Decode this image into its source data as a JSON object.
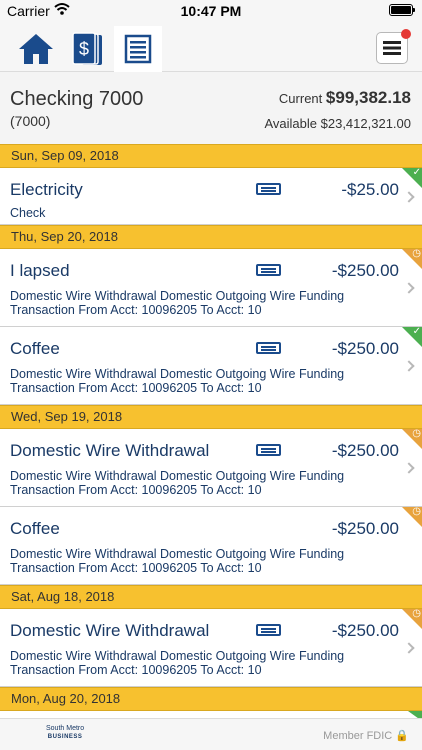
{
  "status_bar": {
    "carrier": "Carrier",
    "time": "10:47 PM"
  },
  "nav": {
    "tabs": [
      {
        "name": "home",
        "icon": "home-icon",
        "active": false
      },
      {
        "name": "money",
        "icon": "money-icon",
        "active": false
      },
      {
        "name": "register",
        "icon": "register-icon",
        "active": true
      }
    ],
    "menu_icon": "hamburger-menu-icon",
    "menu_has_badge": true
  },
  "account": {
    "name": "Checking 7000",
    "number": "(7000)",
    "current_label": "Current",
    "current_amount": "$99,382.18",
    "available_label": "Available",
    "available_amount": "$23,412,321.00"
  },
  "groups": [
    {
      "date": "Sun, Sep 09, 2018",
      "transactions": [
        {
          "description": "Electricity",
          "amount": "-$25.00",
          "sub": "Check",
          "status": "cleared"
        }
      ]
    },
    {
      "date": "Thu, Sep 20, 2018",
      "transactions": [
        {
          "description": "I lapsed",
          "amount": "-$250.00",
          "sub": "Domestic Wire Withdrawal  Domestic Outgoing Wire Funding\nTransaction From Acct: 10096205 To Acct: 10",
          "status": "pending"
        },
        {
          "description": "Coffee",
          "amount": "-$250.00",
          "sub": "Domestic Wire Withdrawal  Domestic Outgoing Wire Funding\nTransaction From Acct: 10096205 To Acct: 10",
          "status": "cleared"
        }
      ]
    },
    {
      "date": "Wed, Sep 19, 2018",
      "transactions": [
        {
          "description": "Domestic Wire Withdrawal",
          "amount": "-$250.00",
          "sub": "Domestic Wire Withdrawal  Domestic Outgoing Wire Funding\nTransaction From Acct: 10096205 To Acct: 10",
          "status": "pending"
        },
        {
          "description": "Coffee",
          "amount": "-$250.00",
          "sub": "Domestic Wire Withdrawal  Domestic Outgoing Wire Funding\nTransaction From Acct: 10096205 To Acct: 10",
          "status": "pending",
          "no_card": true
        }
      ]
    },
    {
      "date": "Sat, Aug 18, 2018",
      "transactions": [
        {
          "description": "Domestic Wire Withdrawal",
          "amount": "-$250.00",
          "sub": "Domestic Wire Withdrawal  Domestic Outgoing Wire Funding\nTransaction From Acct: 10096205 To Acct: 10",
          "status": "pending"
        }
      ]
    },
    {
      "date": "Mon, Aug 20, 2018",
      "transactions": []
    }
  ],
  "footer": {
    "logo_lines": [
      "South",
      "Metro",
      "BUSINESS"
    ],
    "fdic_label": "Member FDIC"
  },
  "colors": {
    "date_header": "#f7c12f",
    "cleared": "#4caf50",
    "pending": "#e8a33d",
    "text_navy": "#1a3a66"
  }
}
